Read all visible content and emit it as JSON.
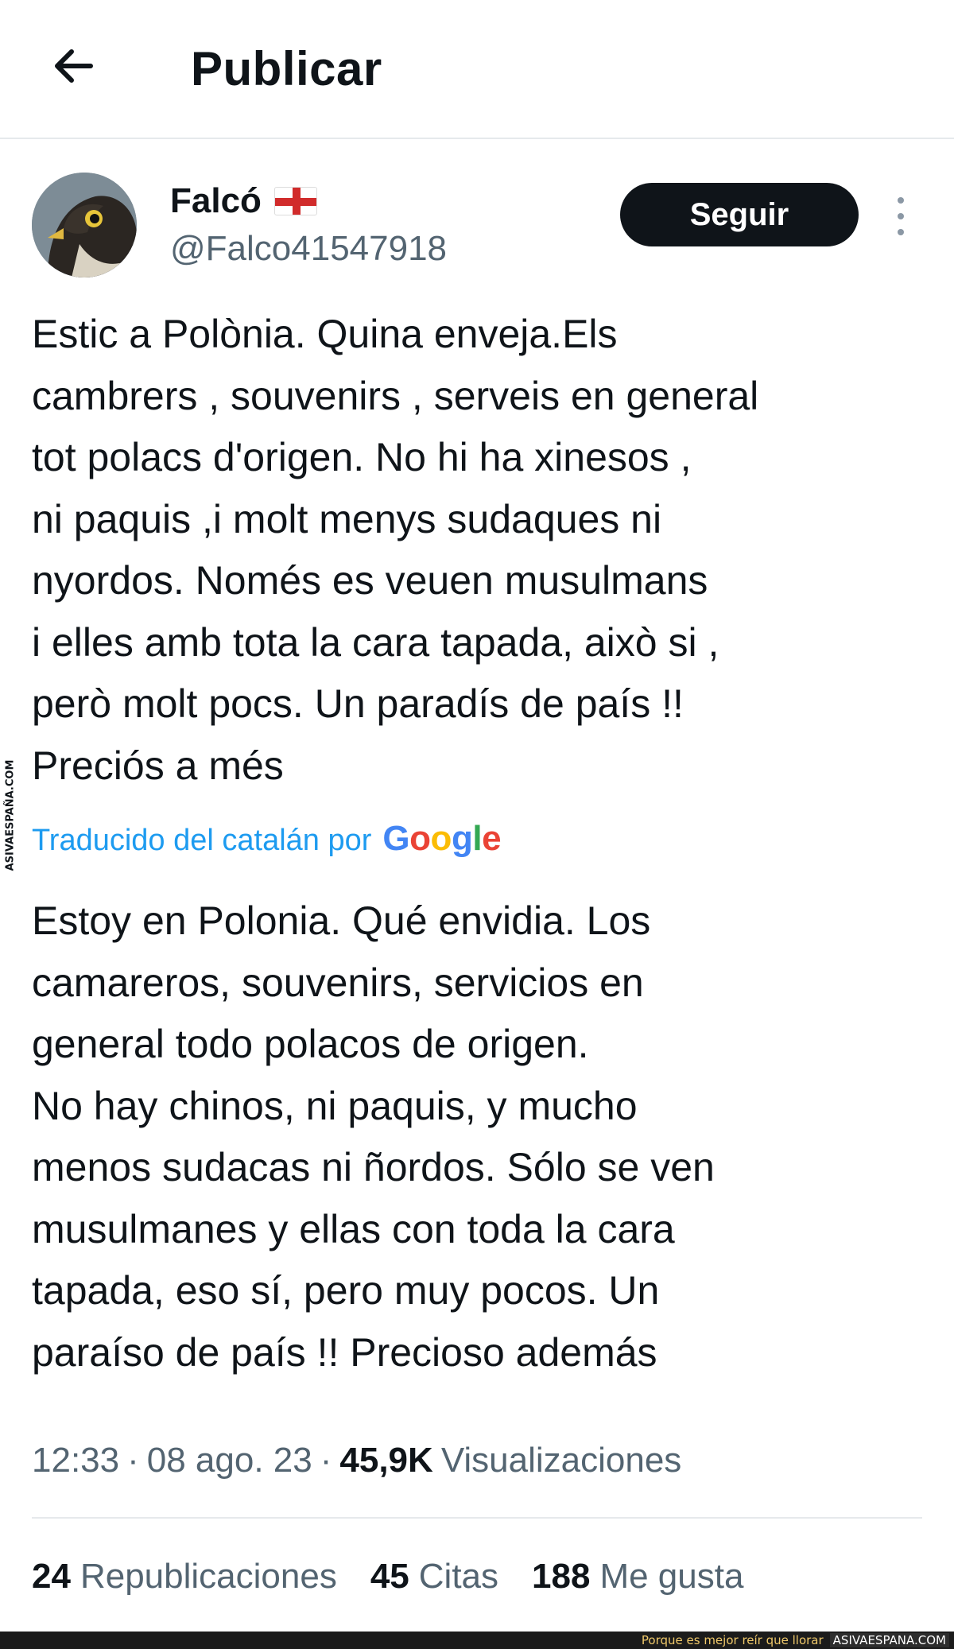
{
  "header": {
    "title": "Publicar",
    "back_icon": "arrow-left-icon"
  },
  "author": {
    "name": "Falcó",
    "flag": "england-flag-icon",
    "handle": "@Falco41547918",
    "follow_label": "Seguir"
  },
  "tweet": {
    "original_text": "Estic a Polònia. Quina enveja.Els\ncambrers , souvenirs , serveis en general\ntot polacs d'origen. No hi ha xinesos ,\nni paquis ,i molt menys sudaques ni\nnyordos. Només es veuen musulmans\ni elles amb tota la cara tapada, això si ,\nperò molt pocs. Un paradís de país !!\nPreciós a més",
    "translation_note": "Traducido del catalán por",
    "translation_provider": "Google",
    "translated_text": "Estoy en Polonia. Qué envidia. Los\ncamareros, souvenirs, servicios en\ngeneral todo polacos de origen.\nNo hay chinos, ni paquis, y mucho\nmenos sudacas ni ñordos. Sólo se ven\nmusulmanes y ellas con toda la cara\ntapada, eso sí, pero muy pocos. Un\nparaíso de país !! Precioso además"
  },
  "meta": {
    "time": "12:33",
    "sep1": "·",
    "date": "08 ago. 23",
    "sep2": "·",
    "views_count": "45,9K",
    "views_label": "Visualizaciones"
  },
  "stats": {
    "reposts_count": "24",
    "reposts_label": "Republicaciones",
    "quotes_count": "45",
    "quotes_label": "Citas",
    "likes_count": "188",
    "likes_label": "Me gusta"
  },
  "watermark": {
    "side_text": "ASIVAESPAÑA.COM",
    "footer_tagline": "Porque es mejor reír que llorar",
    "footer_site": "ASIVAESPANA.COM"
  },
  "colors": {
    "text": "#0f1419",
    "secondary": "#536471",
    "link": "#1d9bf0",
    "button_bg": "#0f1419"
  }
}
